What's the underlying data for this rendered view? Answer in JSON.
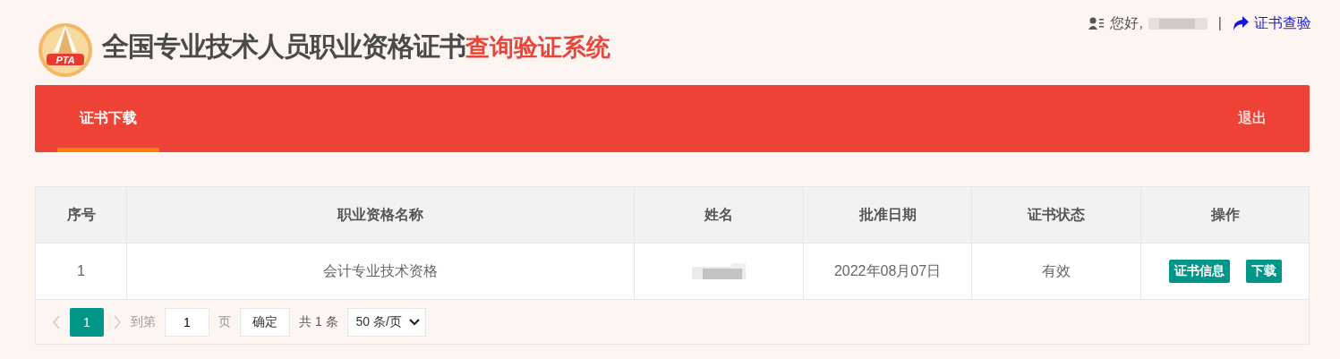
{
  "header": {
    "logo_text": "PTA",
    "title": "全国专业技术人员职业资格证书",
    "title_highlight": "查询验证系统",
    "greeting": "您好,",
    "separator": "|",
    "verify_link": "证书查验"
  },
  "nav": {
    "tabs": [
      {
        "label": "证书下载",
        "selected": true
      }
    ],
    "logout": "退出"
  },
  "table": {
    "columns": [
      "序号",
      "职业资格名称",
      "姓名",
      "批准日期",
      "证书状态",
      "操作"
    ],
    "rows": [
      {
        "index": "1",
        "qualification": "会计专业技术资格",
        "name_redacted": true,
        "date": "2022年08月07日",
        "status": "有效",
        "actions": [
          "证书信息",
          "下载"
        ]
      }
    ]
  },
  "pagination": {
    "pages": [
      {
        "label": "1",
        "selected": true
      }
    ],
    "goto_label": "到第",
    "page_input": "1",
    "page_unit": "页",
    "confirm": "确定",
    "total": "共 1 条",
    "page_size": "50 条/页"
  }
}
